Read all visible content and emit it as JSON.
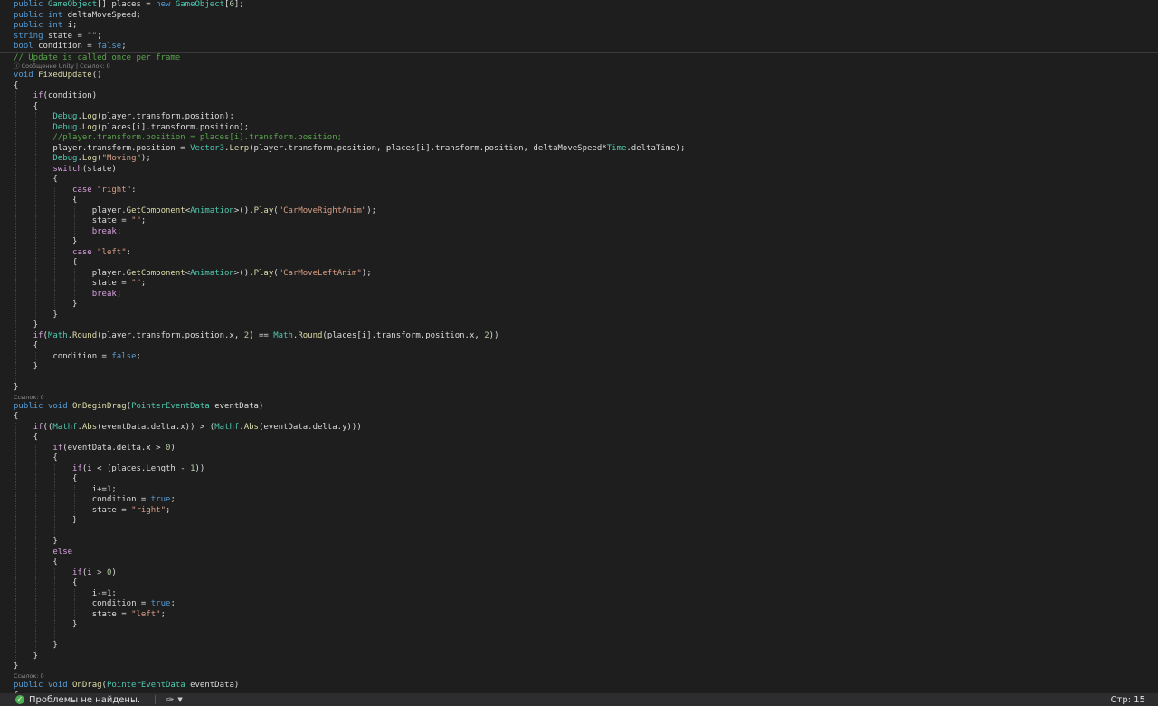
{
  "code": [
    {
      "kind": "code",
      "ind": 0,
      "t": [
        [
          "public ",
          "kw"
        ],
        [
          "GameObject",
          "ty"
        ],
        [
          "[] places = ",
          "id"
        ],
        [
          "new ",
          "kw"
        ],
        [
          "GameObject",
          "ty"
        ],
        [
          "[",
          "id"
        ],
        [
          "0",
          "num"
        ],
        [
          "];",
          "id"
        ]
      ]
    },
    {
      "kind": "code",
      "ind": 0,
      "t": [
        [
          "public ",
          "kw"
        ],
        [
          "int ",
          "kw"
        ],
        [
          "deltaMoveSpeed;",
          "id"
        ]
      ]
    },
    {
      "kind": "code",
      "ind": 0,
      "t": [
        [
          "public ",
          "kw"
        ],
        [
          "int ",
          "kw"
        ],
        [
          "i;",
          "id"
        ]
      ]
    },
    {
      "kind": "code",
      "ind": 0,
      "t": [
        [
          "string ",
          "kw"
        ],
        [
          "state = ",
          "id"
        ],
        [
          "\"\"",
          "str"
        ],
        [
          ";",
          "id"
        ]
      ]
    },
    {
      "kind": "code",
      "ind": 0,
      "t": [
        [
          "bool ",
          "kw"
        ],
        [
          "condition = ",
          "id"
        ],
        [
          "false",
          "kw"
        ],
        [
          ";",
          "id"
        ]
      ]
    },
    {
      "kind": "code",
      "ind": 0,
      "cur": true,
      "t": [
        [
          "// Update is called once per frame",
          "cm"
        ]
      ]
    },
    {
      "kind": "lens",
      "text": "ⓘ Сообщение Unity | Ссылок: 0"
    },
    {
      "kind": "code",
      "ind": 0,
      "t": [
        [
          "void ",
          "kw"
        ],
        [
          "FixedUpdate",
          "mt"
        ],
        [
          "()",
          "id"
        ]
      ]
    },
    {
      "kind": "code",
      "ind": 0,
      "t": [
        [
          "{",
          "id"
        ]
      ]
    },
    {
      "kind": "code",
      "ind": 1,
      "t": [
        [
          "if",
          "ctl"
        ],
        [
          "(condition)",
          "id"
        ]
      ]
    },
    {
      "kind": "code",
      "ind": 1,
      "t": [
        [
          "{",
          "id"
        ]
      ]
    },
    {
      "kind": "code",
      "ind": 2,
      "t": [
        [
          "Debug",
          "ty"
        ],
        [
          ".",
          "id"
        ],
        [
          "Log",
          "mt"
        ],
        [
          "(player.transform.position);",
          "id"
        ]
      ]
    },
    {
      "kind": "code",
      "ind": 2,
      "t": [
        [
          "Debug",
          "ty"
        ],
        [
          ".",
          "id"
        ],
        [
          "Log",
          "mt"
        ],
        [
          "(places[i].transform.position);",
          "id"
        ]
      ]
    },
    {
      "kind": "code",
      "ind": 2,
      "t": [
        [
          "//player.transform.position = places[i].transform.position;",
          "cm"
        ]
      ]
    },
    {
      "kind": "code",
      "ind": 2,
      "t": [
        [
          "player.transform.position = ",
          "id"
        ],
        [
          "Vector3",
          "ty"
        ],
        [
          ".",
          "id"
        ],
        [
          "Lerp",
          "mt"
        ],
        [
          "(player.transform.position, places[i].transform.position, deltaMoveSpeed*",
          "id"
        ],
        [
          "Time",
          "ty"
        ],
        [
          ".deltaTime);",
          "id"
        ]
      ]
    },
    {
      "kind": "code",
      "ind": 2,
      "t": [
        [
          "Debug",
          "ty"
        ],
        [
          ".",
          "id"
        ],
        [
          "Log",
          "mt"
        ],
        [
          "(",
          "id"
        ],
        [
          "\"Moving\"",
          "str"
        ],
        [
          ");",
          "id"
        ]
      ]
    },
    {
      "kind": "code",
      "ind": 2,
      "t": [
        [
          "switch",
          "ctl"
        ],
        [
          "(state)",
          "id"
        ]
      ]
    },
    {
      "kind": "code",
      "ind": 2,
      "t": [
        [
          "{",
          "id"
        ]
      ]
    },
    {
      "kind": "code",
      "ind": 3,
      "t": [
        [
          "case ",
          "ctl"
        ],
        [
          "\"right\"",
          "str"
        ],
        [
          ":",
          "id"
        ]
      ]
    },
    {
      "kind": "code",
      "ind": 3,
      "t": [
        [
          "{",
          "id"
        ]
      ]
    },
    {
      "kind": "code",
      "ind": 4,
      "t": [
        [
          "player.",
          "id"
        ],
        [
          "GetComponent",
          "mt"
        ],
        [
          "<",
          "id"
        ],
        [
          "Animation",
          "ty"
        ],
        [
          ">().",
          "id"
        ],
        [
          "Play",
          "mt"
        ],
        [
          "(",
          "id"
        ],
        [
          "\"CarMoveRightAnim\"",
          "str"
        ],
        [
          ");",
          "id"
        ]
      ]
    },
    {
      "kind": "code",
      "ind": 4,
      "t": [
        [
          "state = ",
          "id"
        ],
        [
          "\"\"",
          "str"
        ],
        [
          ";",
          "id"
        ]
      ]
    },
    {
      "kind": "code",
      "ind": 4,
      "t": [
        [
          "break",
          "ctl"
        ],
        [
          ";",
          "id"
        ]
      ]
    },
    {
      "kind": "code",
      "ind": 3,
      "t": [
        [
          "}",
          "id"
        ]
      ]
    },
    {
      "kind": "code",
      "ind": 3,
      "t": [
        [
          "case ",
          "ctl"
        ],
        [
          "\"left\"",
          "str"
        ],
        [
          ":",
          "id"
        ]
      ]
    },
    {
      "kind": "code",
      "ind": 3,
      "t": [
        [
          "{",
          "id"
        ]
      ]
    },
    {
      "kind": "code",
      "ind": 4,
      "t": [
        [
          "player.",
          "id"
        ],
        [
          "GetComponent",
          "mt"
        ],
        [
          "<",
          "id"
        ],
        [
          "Animation",
          "ty"
        ],
        [
          ">().",
          "id"
        ],
        [
          "Play",
          "mt"
        ],
        [
          "(",
          "id"
        ],
        [
          "\"CarMoveLeftAnim\"",
          "str"
        ],
        [
          ");",
          "id"
        ]
      ]
    },
    {
      "kind": "code",
      "ind": 4,
      "t": [
        [
          "state = ",
          "id"
        ],
        [
          "\"\"",
          "str"
        ],
        [
          ";",
          "id"
        ]
      ]
    },
    {
      "kind": "code",
      "ind": 4,
      "t": [
        [
          "break",
          "ctl"
        ],
        [
          ";",
          "id"
        ]
      ]
    },
    {
      "kind": "code",
      "ind": 3,
      "t": [
        [
          "}",
          "id"
        ]
      ]
    },
    {
      "kind": "code",
      "ind": 2,
      "t": [
        [
          "}",
          "id"
        ]
      ]
    },
    {
      "kind": "code",
      "ind": 1,
      "t": [
        [
          "}",
          "id"
        ]
      ]
    },
    {
      "kind": "code",
      "ind": 1,
      "t": [
        [
          "if",
          "ctl"
        ],
        [
          "(",
          "id"
        ],
        [
          "Math",
          "ty"
        ],
        [
          ".",
          "id"
        ],
        [
          "Round",
          "mt"
        ],
        [
          "(player.transform.position.x, ",
          "id"
        ],
        [
          "2",
          "num"
        ],
        [
          ") == ",
          "id"
        ],
        [
          "Math",
          "ty"
        ],
        [
          ".",
          "id"
        ],
        [
          "Round",
          "mt"
        ],
        [
          "(places[i].transform.position.x, ",
          "id"
        ],
        [
          "2",
          "num"
        ],
        [
          "))",
          "id"
        ]
      ]
    },
    {
      "kind": "code",
      "ind": 1,
      "t": [
        [
          "{",
          "id"
        ]
      ]
    },
    {
      "kind": "code",
      "ind": 2,
      "t": [
        [
          "condition = ",
          "id"
        ],
        [
          "false",
          "kw"
        ],
        [
          ";",
          "id"
        ]
      ]
    },
    {
      "kind": "code",
      "ind": 1,
      "t": [
        [
          "}",
          "id"
        ]
      ]
    },
    {
      "kind": "code",
      "ind": 1,
      "t": []
    },
    {
      "kind": "code",
      "ind": 0,
      "t": [
        [
          "}",
          "id"
        ]
      ]
    },
    {
      "kind": "lens",
      "text": "Ссылок: 0"
    },
    {
      "kind": "code",
      "ind": 0,
      "t": [
        [
          "public ",
          "kw"
        ],
        [
          "void ",
          "kw"
        ],
        [
          "OnBeginDrag",
          "mt"
        ],
        [
          "(",
          "id"
        ],
        [
          "PointerEventData ",
          "ty"
        ],
        [
          "eventData)",
          "id"
        ]
      ]
    },
    {
      "kind": "code",
      "ind": 0,
      "t": [
        [
          "{",
          "id"
        ]
      ]
    },
    {
      "kind": "code",
      "ind": 1,
      "t": [
        [
          "if",
          "ctl"
        ],
        [
          "((",
          "id"
        ],
        [
          "Mathf",
          "ty"
        ],
        [
          ".",
          "id"
        ],
        [
          "Abs",
          "mt"
        ],
        [
          "(eventData.delta.x)) > (",
          "id"
        ],
        [
          "Mathf",
          "ty"
        ],
        [
          ".",
          "id"
        ],
        [
          "Abs",
          "mt"
        ],
        [
          "(eventData.delta.y)))",
          "id"
        ]
      ]
    },
    {
      "kind": "code",
      "ind": 1,
      "t": [
        [
          "{",
          "id"
        ]
      ]
    },
    {
      "kind": "code",
      "ind": 2,
      "t": [
        [
          "if",
          "ctl"
        ],
        [
          "(eventData.delta.x > ",
          "id"
        ],
        [
          "0",
          "num"
        ],
        [
          ")",
          "id"
        ]
      ]
    },
    {
      "kind": "code",
      "ind": 2,
      "t": [
        [
          "{",
          "id"
        ]
      ]
    },
    {
      "kind": "code",
      "ind": 3,
      "t": [
        [
          "if",
          "ctl"
        ],
        [
          "(i < (places.Length - ",
          "id"
        ],
        [
          "1",
          "num"
        ],
        [
          "))",
          "id"
        ]
      ]
    },
    {
      "kind": "code",
      "ind": 3,
      "t": [
        [
          "{",
          "id"
        ]
      ]
    },
    {
      "kind": "code",
      "ind": 4,
      "t": [
        [
          "i+=",
          "id"
        ],
        [
          "1",
          "num"
        ],
        [
          ";",
          "id"
        ]
      ]
    },
    {
      "kind": "code",
      "ind": 4,
      "t": [
        [
          "condition = ",
          "id"
        ],
        [
          "true",
          "kw"
        ],
        [
          ";",
          "id"
        ]
      ]
    },
    {
      "kind": "code",
      "ind": 4,
      "t": [
        [
          "state = ",
          "id"
        ],
        [
          "\"right\"",
          "str"
        ],
        [
          ";",
          "id"
        ]
      ]
    },
    {
      "kind": "code",
      "ind": 3,
      "t": [
        [
          "}",
          "id"
        ]
      ]
    },
    {
      "kind": "code",
      "ind": 3,
      "t": []
    },
    {
      "kind": "code",
      "ind": 2,
      "t": [
        [
          "}",
          "id"
        ]
      ]
    },
    {
      "kind": "code",
      "ind": 2,
      "t": [
        [
          "else",
          "ctl"
        ]
      ]
    },
    {
      "kind": "code",
      "ind": 2,
      "t": [
        [
          "{",
          "id"
        ]
      ]
    },
    {
      "kind": "code",
      "ind": 3,
      "t": [
        [
          "if",
          "ctl"
        ],
        [
          "(i > ",
          "id"
        ],
        [
          "0",
          "num"
        ],
        [
          ")",
          "id"
        ]
      ]
    },
    {
      "kind": "code",
      "ind": 3,
      "t": [
        [
          "{",
          "id"
        ]
      ]
    },
    {
      "kind": "code",
      "ind": 4,
      "t": [
        [
          "i-=",
          "id"
        ],
        [
          "1",
          "num"
        ],
        [
          ";",
          "id"
        ]
      ]
    },
    {
      "kind": "code",
      "ind": 4,
      "t": [
        [
          "condition = ",
          "id"
        ],
        [
          "true",
          "kw"
        ],
        [
          ";",
          "id"
        ]
      ]
    },
    {
      "kind": "code",
      "ind": 4,
      "t": [
        [
          "state = ",
          "id"
        ],
        [
          "\"left\"",
          "str"
        ],
        [
          ";",
          "id"
        ]
      ]
    },
    {
      "kind": "code",
      "ind": 3,
      "t": [
        [
          "}",
          "id"
        ]
      ]
    },
    {
      "kind": "code",
      "ind": 3,
      "t": []
    },
    {
      "kind": "code",
      "ind": 2,
      "t": [
        [
          "}",
          "id"
        ]
      ]
    },
    {
      "kind": "code",
      "ind": 1,
      "t": [
        [
          "}",
          "id"
        ]
      ]
    },
    {
      "kind": "code",
      "ind": 0,
      "t": [
        [
          "}",
          "id"
        ]
      ]
    },
    {
      "kind": "lens",
      "text": "Ссылок: 0"
    },
    {
      "kind": "code",
      "ind": 0,
      "t": [
        [
          "public ",
          "kw"
        ],
        [
          "void ",
          "kw"
        ],
        [
          "OnDrag",
          "mt"
        ],
        [
          "(",
          "id"
        ],
        [
          "PointerEventData ",
          "ty"
        ],
        [
          "eventData)",
          "id"
        ]
      ]
    },
    {
      "kind": "code",
      "ind": 0,
      "t": [
        [
          "{",
          "id"
        ]
      ]
    }
  ],
  "statusbar": {
    "problems": "Проблемы не найдены.",
    "ok_icon": "check-circle-icon",
    "cleanup_icon": "brush-icon",
    "position": "Стр: 15"
  }
}
